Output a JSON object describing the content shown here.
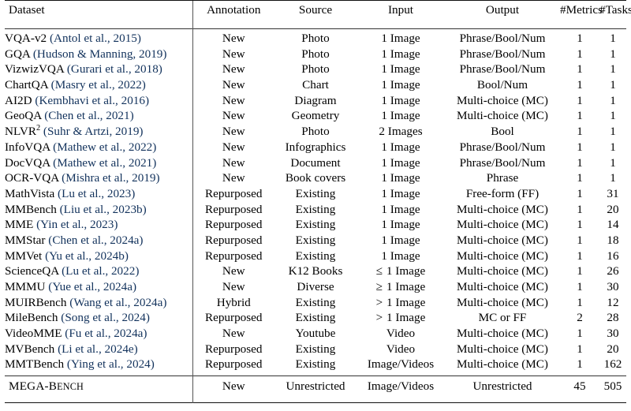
{
  "table": {
    "columns": [
      {
        "key": "dataset",
        "label": "Dataset",
        "align": "left"
      },
      {
        "key": "annotation",
        "label": "Annotation",
        "align": "center"
      },
      {
        "key": "source",
        "label": "Source",
        "align": "center"
      },
      {
        "key": "input",
        "label": "Input",
        "align": "center"
      },
      {
        "key": "output",
        "label": "Output",
        "align": "center"
      },
      {
        "key": "metrics",
        "label": "#Metrics",
        "align": "center"
      },
      {
        "key": "tasks",
        "label": "#Tasks",
        "align": "center"
      }
    ],
    "rows": [
      {
        "name": "VQA-v2",
        "name_sup": "",
        "citation": "(Antol et al., 2015)",
        "annotation": "New",
        "source": "Photo",
        "input": "1 Image",
        "input_op": "",
        "output": "Phrase/Bool/Num",
        "metrics": "1",
        "tasks": "1"
      },
      {
        "name": "GQA",
        "name_sup": "",
        "citation": "(Hudson & Manning, 2019)",
        "annotation": "New",
        "source": "Photo",
        "input": "1 Image",
        "input_op": "",
        "output": "Phrase/Bool/Num",
        "metrics": "1",
        "tasks": "1"
      },
      {
        "name": "VizwizVQA",
        "name_sup": "",
        "citation": "(Gurari et al., 2018)",
        "annotation": "New",
        "source": "Photo",
        "input": "1 Image",
        "input_op": "",
        "output": "Phrase/Bool/Num",
        "metrics": "1",
        "tasks": "1"
      },
      {
        "name": "ChartQA",
        "name_sup": "",
        "citation": "(Masry et al., 2022)",
        "annotation": "New",
        "source": "Chart",
        "input": "1 Image",
        "input_op": "",
        "output": "Bool/Num",
        "metrics": "1",
        "tasks": "1"
      },
      {
        "name": "AI2D",
        "name_sup": "",
        "citation": "(Kembhavi et al., 2016)",
        "annotation": "New",
        "source": "Diagram",
        "input": "1 Image",
        "input_op": "",
        "output": "Multi-choice (MC)",
        "metrics": "1",
        "tasks": "1"
      },
      {
        "name": "GeoQA",
        "name_sup": "",
        "citation": "(Chen et al., 2021)",
        "annotation": "New",
        "source": "Geometry",
        "input": "1 Image",
        "input_op": "",
        "output": "Multi-choice (MC)",
        "metrics": "1",
        "tasks": "1"
      },
      {
        "name": "NLVR",
        "name_sup": "2",
        "citation": "(Suhr & Artzi, 2019)",
        "annotation": "New",
        "source": "Photo",
        "input": "2 Images",
        "input_op": "",
        "output": "Bool",
        "metrics": "1",
        "tasks": "1"
      },
      {
        "name": "InfoVQA",
        "name_sup": "",
        "citation": "(Mathew et al., 2022)",
        "annotation": "New",
        "source": "Infographics",
        "input": "1 Image",
        "input_op": "",
        "output": "Phrase/Bool/Num",
        "metrics": "1",
        "tasks": "1"
      },
      {
        "name": "DocVQA",
        "name_sup": "",
        "citation": "(Mathew et al., 2021)",
        "annotation": "New",
        "source": "Document",
        "input": "1 Image",
        "input_op": "",
        "output": "Phrase/Bool/Num",
        "metrics": "1",
        "tasks": "1"
      },
      {
        "name": "OCR-VQA",
        "name_sup": "",
        "citation": "(Mishra et al., 2019)",
        "annotation": "New",
        "source": "Book covers",
        "input": "1 Image",
        "input_op": "",
        "output": "Phrase",
        "metrics": "1",
        "tasks": "1"
      },
      {
        "name": "MathVista",
        "name_sup": "",
        "citation": "(Lu et al., 2023)",
        "annotation": "Repurposed",
        "source": "Existing",
        "input": "1 Image",
        "input_op": "",
        "output": "Free-form (FF)",
        "metrics": "1",
        "tasks": "31"
      },
      {
        "name": "MMBench",
        "name_sup": "",
        "citation": "(Liu et al., 2023b)",
        "annotation": "Repurposed",
        "source": "Existing",
        "input": "1 Image",
        "input_op": "",
        "output": "Multi-choice (MC)",
        "metrics": "1",
        "tasks": "20"
      },
      {
        "name": "MME",
        "name_sup": "",
        "citation": "(Yin et al., 2023)",
        "annotation": "Repurposed",
        "source": "Existing",
        "input": "1 Image",
        "input_op": "",
        "output": "Multi-choice (MC)",
        "metrics": "1",
        "tasks": "14"
      },
      {
        "name": "MMStar",
        "name_sup": "",
        "citation": "(Chen et al., 2024a)",
        "annotation": "Repurposed",
        "source": "Existing",
        "input": "1 Image",
        "input_op": "",
        "output": "Multi-choice (MC)",
        "metrics": "1",
        "tasks": "18"
      },
      {
        "name": "MMVet",
        "name_sup": "",
        "citation": "(Yu et al., 2024b)",
        "annotation": "Repurposed",
        "source": "Existing",
        "input": "1 Image",
        "input_op": "",
        "output": "Multi-choice (MC)",
        "metrics": "1",
        "tasks": "16"
      },
      {
        "name": "ScienceQA",
        "name_sup": "",
        "citation": "(Lu et al., 2022)",
        "annotation": "New",
        "source": "K12 Books",
        "input": "1 Image",
        "input_op": "≤",
        "output": "Multi-choice (MC)",
        "metrics": "1",
        "tasks": "26"
      },
      {
        "name": "MMMU",
        "name_sup": "",
        "citation": "(Yue et al., 2024a)",
        "annotation": "New",
        "source": "Diverse",
        "input": "1 Image",
        "input_op": "≥",
        "output": "Multi-choice (MC)",
        "metrics": "1",
        "tasks": "30"
      },
      {
        "name": "MUIRBench",
        "name_sup": "",
        "citation": "(Wang et al., 2024a)",
        "annotation": "Hybrid",
        "source": "Existing",
        "input": "1 Image",
        "input_op": ">",
        "output": "Multi-choice (MC)",
        "metrics": "1",
        "tasks": "12"
      },
      {
        "name": "MileBench",
        "name_sup": "",
        "citation": "(Song et al., 2024)",
        "annotation": "Repurposed",
        "source": "Existing",
        "input": "1 Image",
        "input_op": ">",
        "output": "MC or FF",
        "metrics": "2",
        "tasks": "28"
      },
      {
        "name": "VideoMME",
        "name_sup": "",
        "citation": "(Fu et al., 2024a)",
        "annotation": "New",
        "source": "Youtube",
        "input": "Video",
        "input_op": "",
        "output": "Multi-choice (MC)",
        "metrics": "1",
        "tasks": "30"
      },
      {
        "name": "MVBench",
        "name_sup": "",
        "citation": "(Li et al., 2024e)",
        "annotation": "Repurposed",
        "source": "Existing",
        "input": "Video",
        "input_op": "",
        "output": "Multi-choice (MC)",
        "metrics": "1",
        "tasks": "20"
      },
      {
        "name": "MMTBench",
        "name_sup": "",
        "citation": "(Ying et al., 2024)",
        "annotation": "Repurposed",
        "source": "Existing",
        "input": "Image/Videos",
        "input_op": "",
        "output": "Multi-choice (MC)",
        "metrics": "1",
        "tasks": "162"
      }
    ],
    "summary_row": {
      "name_big": "MEGA-B",
      "name_small": "ENCH",
      "annotation": "New",
      "source": "Unrestricted",
      "input": "Image/Videos",
      "output": "Unrestricted",
      "metrics": "45",
      "tasks": "505"
    }
  },
  "colors": {
    "citation": "#12325c",
    "text": "#000000",
    "rule": "#111111"
  }
}
